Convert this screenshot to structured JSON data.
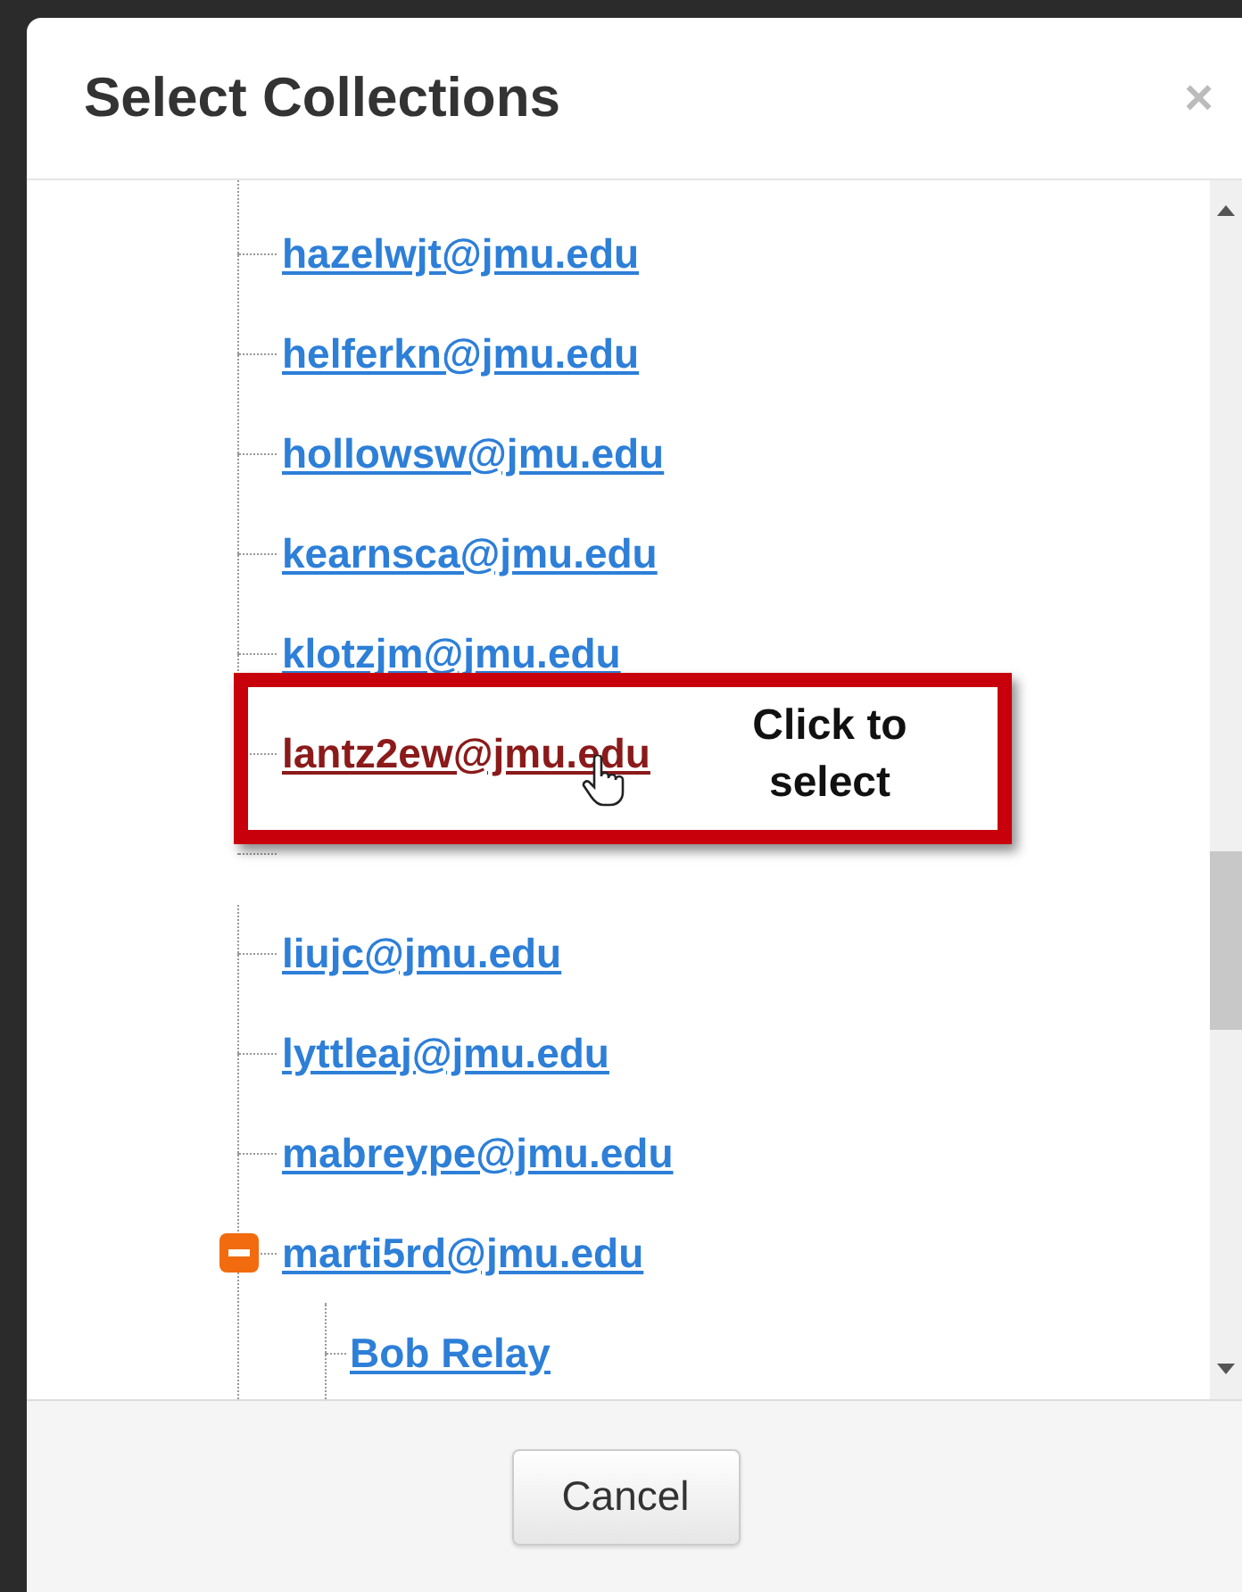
{
  "dialog": {
    "title": "Select Collections",
    "close": "×"
  },
  "tree": [
    {
      "label": "hazelwjt@jmu.edu",
      "kind": "leaf",
      "hovered": false
    },
    {
      "label": "helferkn@jmu.edu",
      "kind": "leaf",
      "hovered": false
    },
    {
      "label": "hollowsw@jmu.edu",
      "kind": "leaf",
      "hovered": false
    },
    {
      "label": "kearnsca@jmu.edu",
      "kind": "leaf",
      "hovered": false
    },
    {
      "label": "klotzjm@jmu.edu",
      "kind": "leaf",
      "hovered": false
    },
    {
      "label": "lantz2ew@jmu.edu",
      "kind": "leaf",
      "hovered": true
    },
    {
      "label": "liujc@jmu.edu",
      "kind": "leaf",
      "hovered": false
    },
    {
      "label": "lyttleaj@jmu.edu",
      "kind": "leaf",
      "hovered": false
    },
    {
      "label": "mabreype@jmu.edu",
      "kind": "leaf",
      "hovered": false
    },
    {
      "label": "marti5rd@jmu.edu",
      "kind": "group",
      "expanded": true,
      "hovered": false,
      "children": [
        {
          "label": "Bob Relay",
          "hovered": false
        }
      ]
    }
  ],
  "callout": {
    "text": "Click to select"
  },
  "buttons": [
    "Cancel"
  ]
}
